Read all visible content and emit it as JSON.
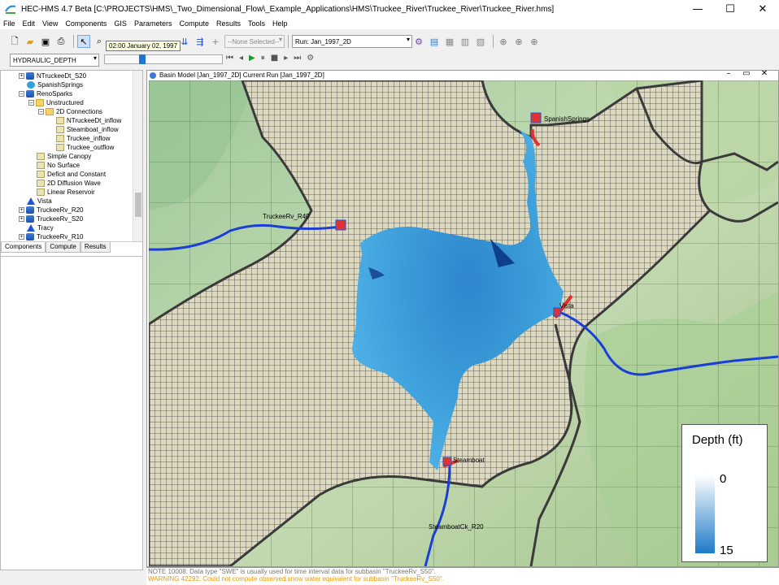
{
  "app": {
    "title": "HEC-HMS 4.7 Beta [C:\\PROJECTS\\HMS\\_Two_Dimensional_Flow\\_Example_Applications\\HMS\\Truckee_River\\Truckee_River\\Truckee_River.hms]",
    "minimize": "—",
    "maximize": "☐",
    "close": "✕"
  },
  "menu": [
    "File",
    "Edit",
    "View",
    "Components",
    "GIS",
    "Parameters",
    "Compute",
    "Results",
    "Tools",
    "Help"
  ],
  "toolbar": {
    "selector_value": "--None Selected--",
    "run_value": "Run: Jan_1997_2D",
    "icons": [
      "new-file-icon",
      "open-folder-icon",
      "save-icon",
      "print-icon",
      "pointer-icon",
      "zoom-icon",
      "pan-icon",
      "add-subbasin-icon",
      "add-reach-icon",
      "add-junction-icon",
      "add-element-icon",
      "compute-icon",
      "compute-all-icon",
      "globe-icon"
    ]
  },
  "animation": {
    "variable": "HYDRAULIC_DEPTH",
    "tooltip": "02:00 January 02, 1997",
    "position_fraction": 0.3
  },
  "tree": {
    "items": [
      {
        "label": "NTruckeeDt_S20",
        "icon": "basin",
        "indent": 0,
        "expander": "+"
      },
      {
        "label": "SpanishSprings",
        "icon": "source",
        "indent": 0,
        "expander": ""
      },
      {
        "label": "RenoSparks",
        "icon": "basin",
        "indent": 0,
        "expander": "−"
      },
      {
        "label": "Unstructured",
        "icon": "folder",
        "indent": 1,
        "expander": "−"
      },
      {
        "label": "2D Connections",
        "icon": "folder",
        "indent": 2,
        "expander": "−"
      },
      {
        "label": "NTruckeeDt_inflow",
        "icon": "method",
        "indent": 3,
        "expander": ""
      },
      {
        "label": "Steamboat_inflow",
        "icon": "method",
        "indent": 3,
        "expander": ""
      },
      {
        "label": "Truckee_inflow",
        "icon": "method",
        "indent": 3,
        "expander": ""
      },
      {
        "label": "Truckee_outflow",
        "icon": "method",
        "indent": 3,
        "expander": ""
      },
      {
        "label": "Simple Canopy",
        "icon": "method",
        "indent": 1,
        "expander": ""
      },
      {
        "label": "No Surface",
        "icon": "method",
        "indent": 1,
        "expander": ""
      },
      {
        "label": "Deficit and Constant",
        "icon": "method",
        "indent": 1,
        "expander": ""
      },
      {
        "label": "2D Diffusion Wave",
        "icon": "method",
        "indent": 1,
        "expander": ""
      },
      {
        "label": "Linear Reservoir",
        "icon": "method",
        "indent": 1,
        "expander": ""
      },
      {
        "label": "Vista",
        "icon": "junction",
        "indent": 0,
        "expander": ""
      },
      {
        "label": "TruckeeRv_R20",
        "icon": "basin",
        "indent": 0,
        "expander": "+"
      },
      {
        "label": "TruckeeRv_S20",
        "icon": "basin",
        "indent": 0,
        "expander": "+"
      },
      {
        "label": "Tracy",
        "icon": "junction",
        "indent": 0,
        "expander": ""
      },
      {
        "label": "TruckeeRv_R10",
        "icon": "basin",
        "indent": 0,
        "expander": "+"
      }
    ]
  },
  "tabs": [
    "Components",
    "Compute",
    "Results"
  ],
  "map": {
    "window_title": "Basin Model [Jan_1997_2D] Current Run [Jan_1997_2D]",
    "labels": {
      "spanish_springs": "SpanishSprings",
      "truckee_r40": "TruckeeRv_R40",
      "vista": "Vista",
      "steamboat": "Steamboat",
      "steamboat_r20": "SteamboatCk_R20"
    }
  },
  "legend": {
    "title": "Depth (ft)",
    "min": "0",
    "max": "15",
    "color_low": "#ffffff",
    "color_high": "#1e7ac8"
  },
  "console": {
    "line1": "NOTE 10008: Data type \"SWE\" is usually used for time interval data for subbasin \"TruckeeRv_S50\".",
    "line2": "WARNING 42292:  Could not compute observed snow water equivalent for subbasin \"TruckeeRv_S50\"."
  }
}
